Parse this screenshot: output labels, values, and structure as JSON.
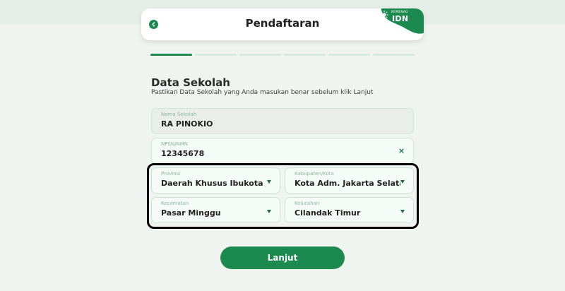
{
  "header": {
    "title": "Pendaftaran",
    "brand_small": "KEMENAG",
    "brand_name": "IDN"
  },
  "progress": {
    "total_steps": 6,
    "current_step": 1
  },
  "section": {
    "title": "Data Sekolah",
    "subtitle": "Pastikan Data Sekolah yang Anda masukan benar sebelum klik Lanjut"
  },
  "fields": {
    "nama_sekolah": {
      "label": "Nama Sekolah",
      "value": "RA PINOKIO"
    },
    "npsn": {
      "label": "NPSN/NMN",
      "value": "12345678",
      "clear": "×"
    },
    "provinsi": {
      "label": "Provinsi",
      "value": "Daerah Khusus Ibukota Jakarta"
    },
    "kabupaten": {
      "label": "Kabupaten/Kota",
      "value": "Kota Adm. Jakarta Selatan"
    },
    "kecamatan": {
      "label": "Kecamatan",
      "value": "Pasar Minggu"
    },
    "kelurahan": {
      "label": "Kelurahan",
      "value": "Cilandak Timur"
    }
  },
  "actions": {
    "submit_label": "Lanjut"
  },
  "colors": {
    "primary": "#1c8a4e",
    "background": "#eff4f0",
    "field_border": "#cfe3d6",
    "field_label": "#8fb5a0"
  },
  "icons": [
    "chevron-left-icon",
    "sun-icon",
    "close-icon",
    "caret-down-icon"
  ]
}
